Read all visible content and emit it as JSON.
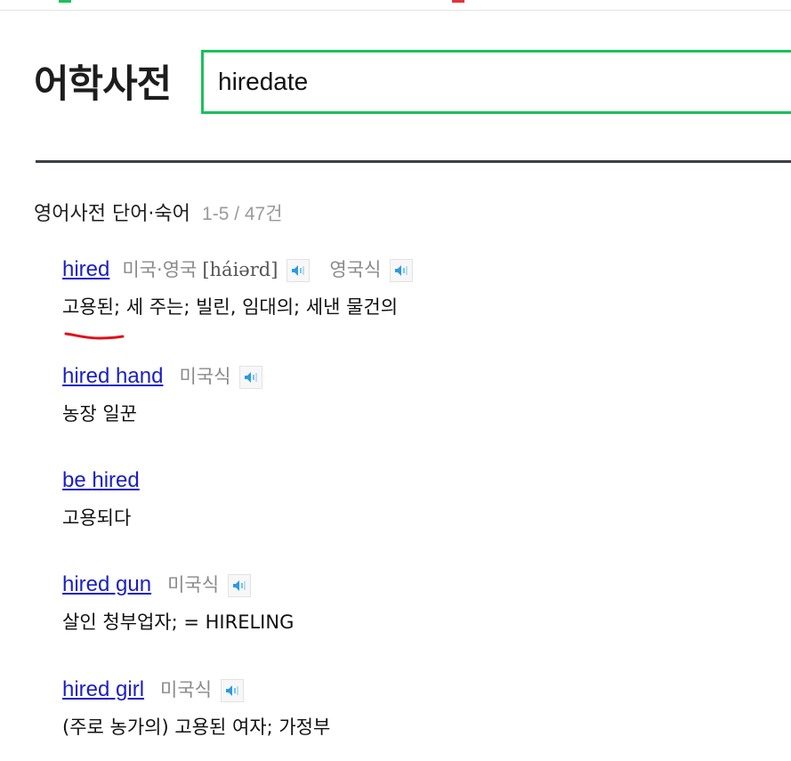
{
  "header": {
    "logo": "어학사전",
    "search_value": "hiredate"
  },
  "section": {
    "title": "영어사전 단어·숙어",
    "count": "1-5 / 47건"
  },
  "entries": [
    {
      "word_prefix": "",
      "word": "hired",
      "word_suffix": "",
      "regions": [
        "미국·영국",
        "영국식"
      ],
      "phonetic": "[háiərd]",
      "meaning": "고용된; 세 주는; 빌린, 임대의; 세낸 물건의"
    },
    {
      "word_prefix": "",
      "word": "hired",
      "word_suffix": " hand",
      "regions": [
        "미국식"
      ],
      "meaning": "농장 일꾼"
    },
    {
      "word_prefix": "be ",
      "word": "hired",
      "word_suffix": "",
      "regions": [],
      "meaning": "고용되다"
    },
    {
      "word_prefix": "",
      "word": "hired",
      "word_suffix": " gun",
      "regions": [
        "미국식"
      ],
      "meaning": "살인 청부업자; = HIRELING"
    },
    {
      "word_prefix": "",
      "word": "hired",
      "word_suffix": " girl",
      "regions": [
        "미국식"
      ],
      "meaning": "(주로 농가의) 고용된 여자; 가정부"
    }
  ],
  "icons": {
    "speaker": "speaker-icon"
  },
  "colors": {
    "accent": "#19c15a",
    "link": "#1a1fc5",
    "divider": "#3b3f45",
    "muted": "#8a8a8a",
    "annotation": "#e0101a"
  }
}
